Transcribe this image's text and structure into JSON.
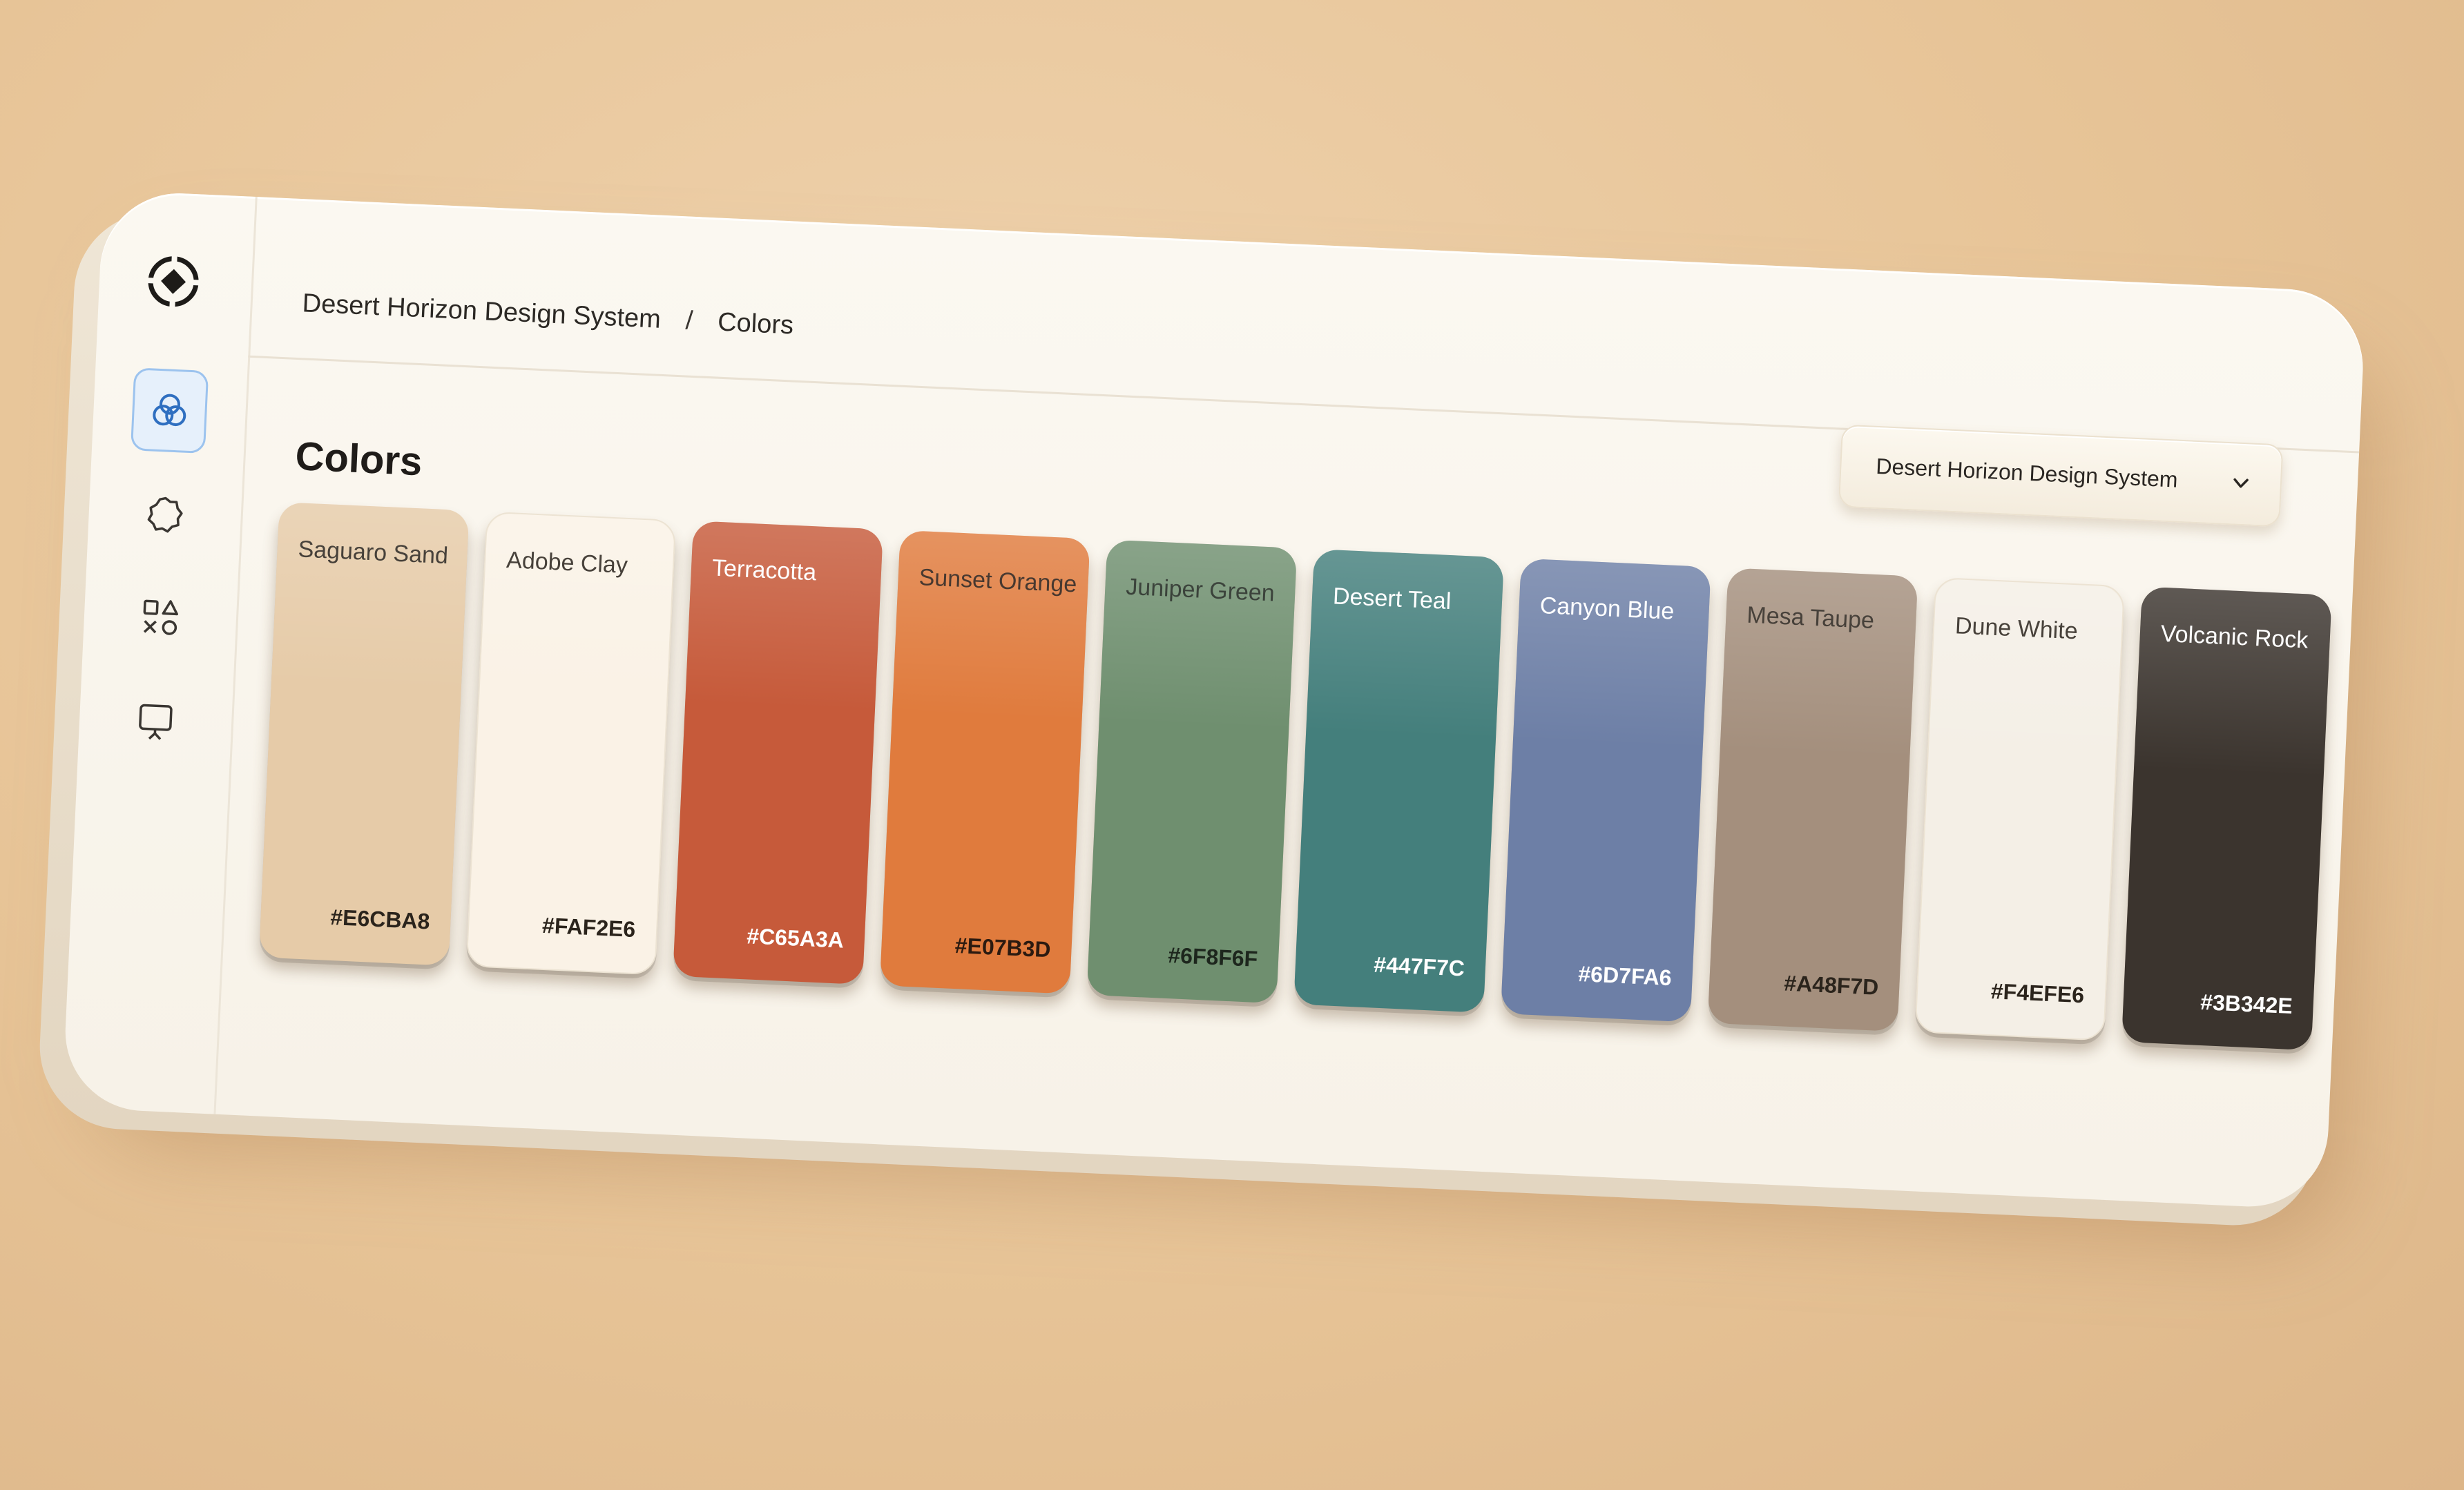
{
  "breadcrumb": {
    "root": "Desert Horizon Design System",
    "separator": "/",
    "current": "Colors"
  },
  "page": {
    "title": "Colors"
  },
  "design_system_select": {
    "selected": "Desert Horizon Design System"
  },
  "sidebar": {
    "logo_icon": "target-logo-icon",
    "items": [
      {
        "icon": "color-circles-icon",
        "active": true
      },
      {
        "icon": "badge-shape-icon",
        "active": false
      },
      {
        "icon": "shapes-icon",
        "active": false
      },
      {
        "icon": "presentation-icon",
        "active": false
      }
    ],
    "accent_color": "#4a90e2"
  },
  "swatches": [
    {
      "name": "Saguaro Sand",
      "hex": "#E6CBA8",
      "color": "#E6CBA8",
      "text_color": "#2b241c"
    },
    {
      "name": "Adobe Clay",
      "hex": "#FAF2E6",
      "color": "#FAF2E6",
      "text_color": "#2b241c"
    },
    {
      "name": "Terracotta",
      "hex": "#C65A3A",
      "color": "#C65A3A",
      "text_color": "#ffffff"
    },
    {
      "name": "Sunset Orange",
      "hex": "#E07B3D",
      "color": "#E07B3D",
      "text_color": "#2b1a10"
    },
    {
      "name": "Juniper Green",
      "hex": "#6F8F6F",
      "color": "#6F8F6F",
      "text_color": "#1d261d"
    },
    {
      "name": "Desert Teal",
      "hex": "#447F7C",
      "color": "#447F7C",
      "text_color": "#ffffff"
    },
    {
      "name": "Canyon Blue",
      "hex": "#6D7FA6",
      "color": "#6D7FA6",
      "text_color": "#ffffff"
    },
    {
      "name": "Mesa Taupe",
      "hex": "#A48F7D",
      "color": "#A48F7D",
      "text_color": "#2b241c"
    },
    {
      "name": "Dune White",
      "hex": "#F4EFE6",
      "color": "#F4EFE6",
      "text_color": "#2b241c"
    },
    {
      "name": "Volcanic Rock",
      "hex": "#3B342E",
      "color": "#3B342E",
      "text_color": "#ffffff"
    }
  ]
}
